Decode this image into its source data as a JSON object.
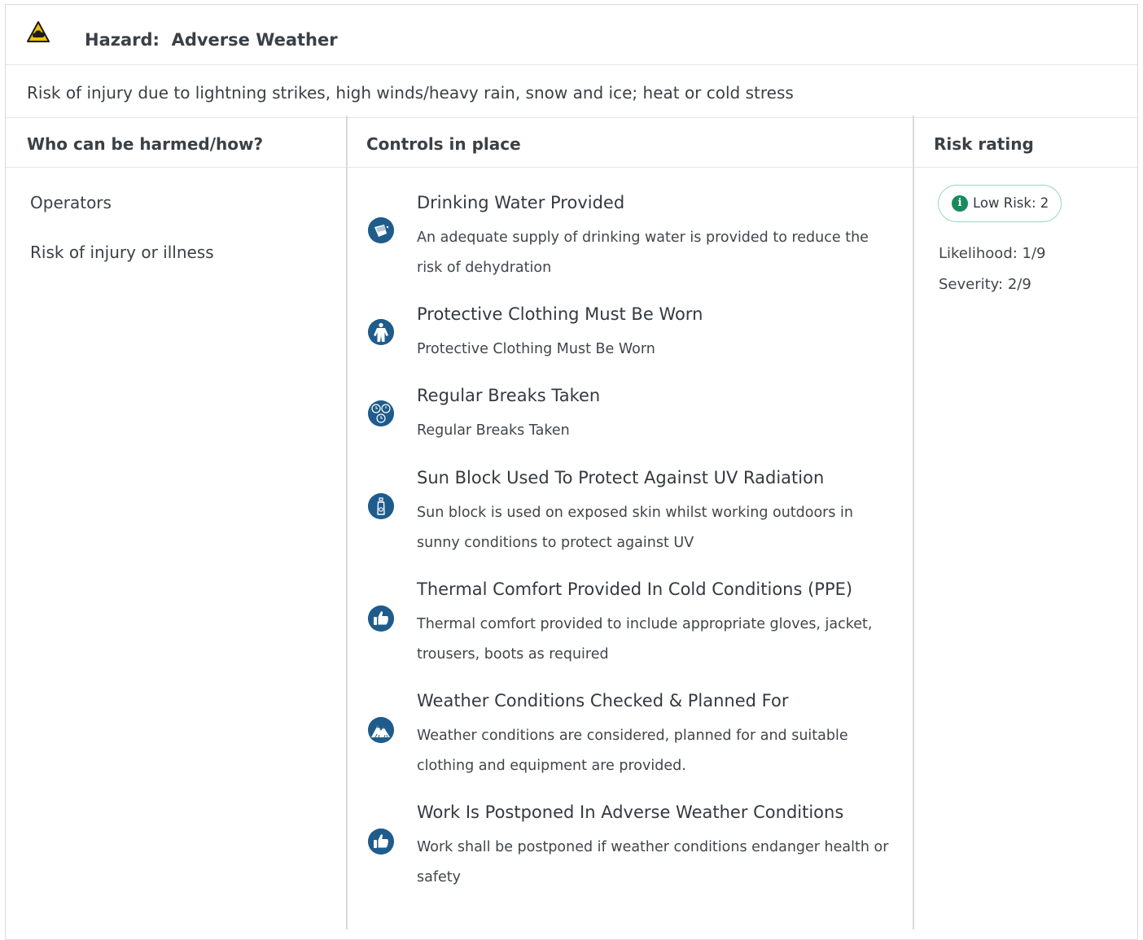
{
  "hazard": {
    "label": "Hazard:",
    "name": "Adverse Weather",
    "description": "Risk of injury due to lightning strikes, high winds/heavy rain, snow and ice; heat or cold stress"
  },
  "columns": {
    "who": "Who can be harmed/how?",
    "controls": "Controls in place",
    "rating": "Risk rating"
  },
  "who": [
    "Operators",
    "Risk of injury or illness"
  ],
  "controls": [
    {
      "icon": "drinking-water-icon",
      "title": "Drinking Water Provided",
      "description": "An adequate supply of drinking water is provided to reduce the risk of dehydration"
    },
    {
      "icon": "protective-clothing-icon",
      "title": "Protective Clothing Must Be Worn",
      "description": "Protective Clothing Must Be Worn"
    },
    {
      "icon": "clock-breaks-icon",
      "title": "Regular Breaks Taken",
      "description": "Regular Breaks Taken"
    },
    {
      "icon": "sun-block-bottle-icon",
      "title": "Sun Block Used To Protect Against UV Radiation",
      "description": "Sun block is used on exposed skin whilst working outdoors in sunny conditions to protect against UV"
    },
    {
      "icon": "thumbs-up-icon",
      "title": "Thermal Comfort Provided In Cold Conditions (PPE)",
      "description": "Thermal comfort provided to include appropriate gloves, jacket, trousers, boots as required"
    },
    {
      "icon": "weather-mountain-icon",
      "title": "Weather Conditions Checked & Planned For",
      "description": "Weather conditions are considered, planned for and suitable clothing and equipment are provided."
    },
    {
      "icon": "thumbs-up-icon",
      "title": "Work Is Postponed In Adverse Weather Conditions",
      "description": "Work shall be postponed if weather conditions endanger health or safety"
    }
  ],
  "rating": {
    "badge": "Low Risk: 2",
    "likelihood": "Likelihood: 1/9",
    "severity": "Severity: 2/9"
  },
  "colors": {
    "icon_blue": "#1f5c8c",
    "low_risk_green": "#198a5e",
    "warning_yellow": "#f2c200"
  }
}
